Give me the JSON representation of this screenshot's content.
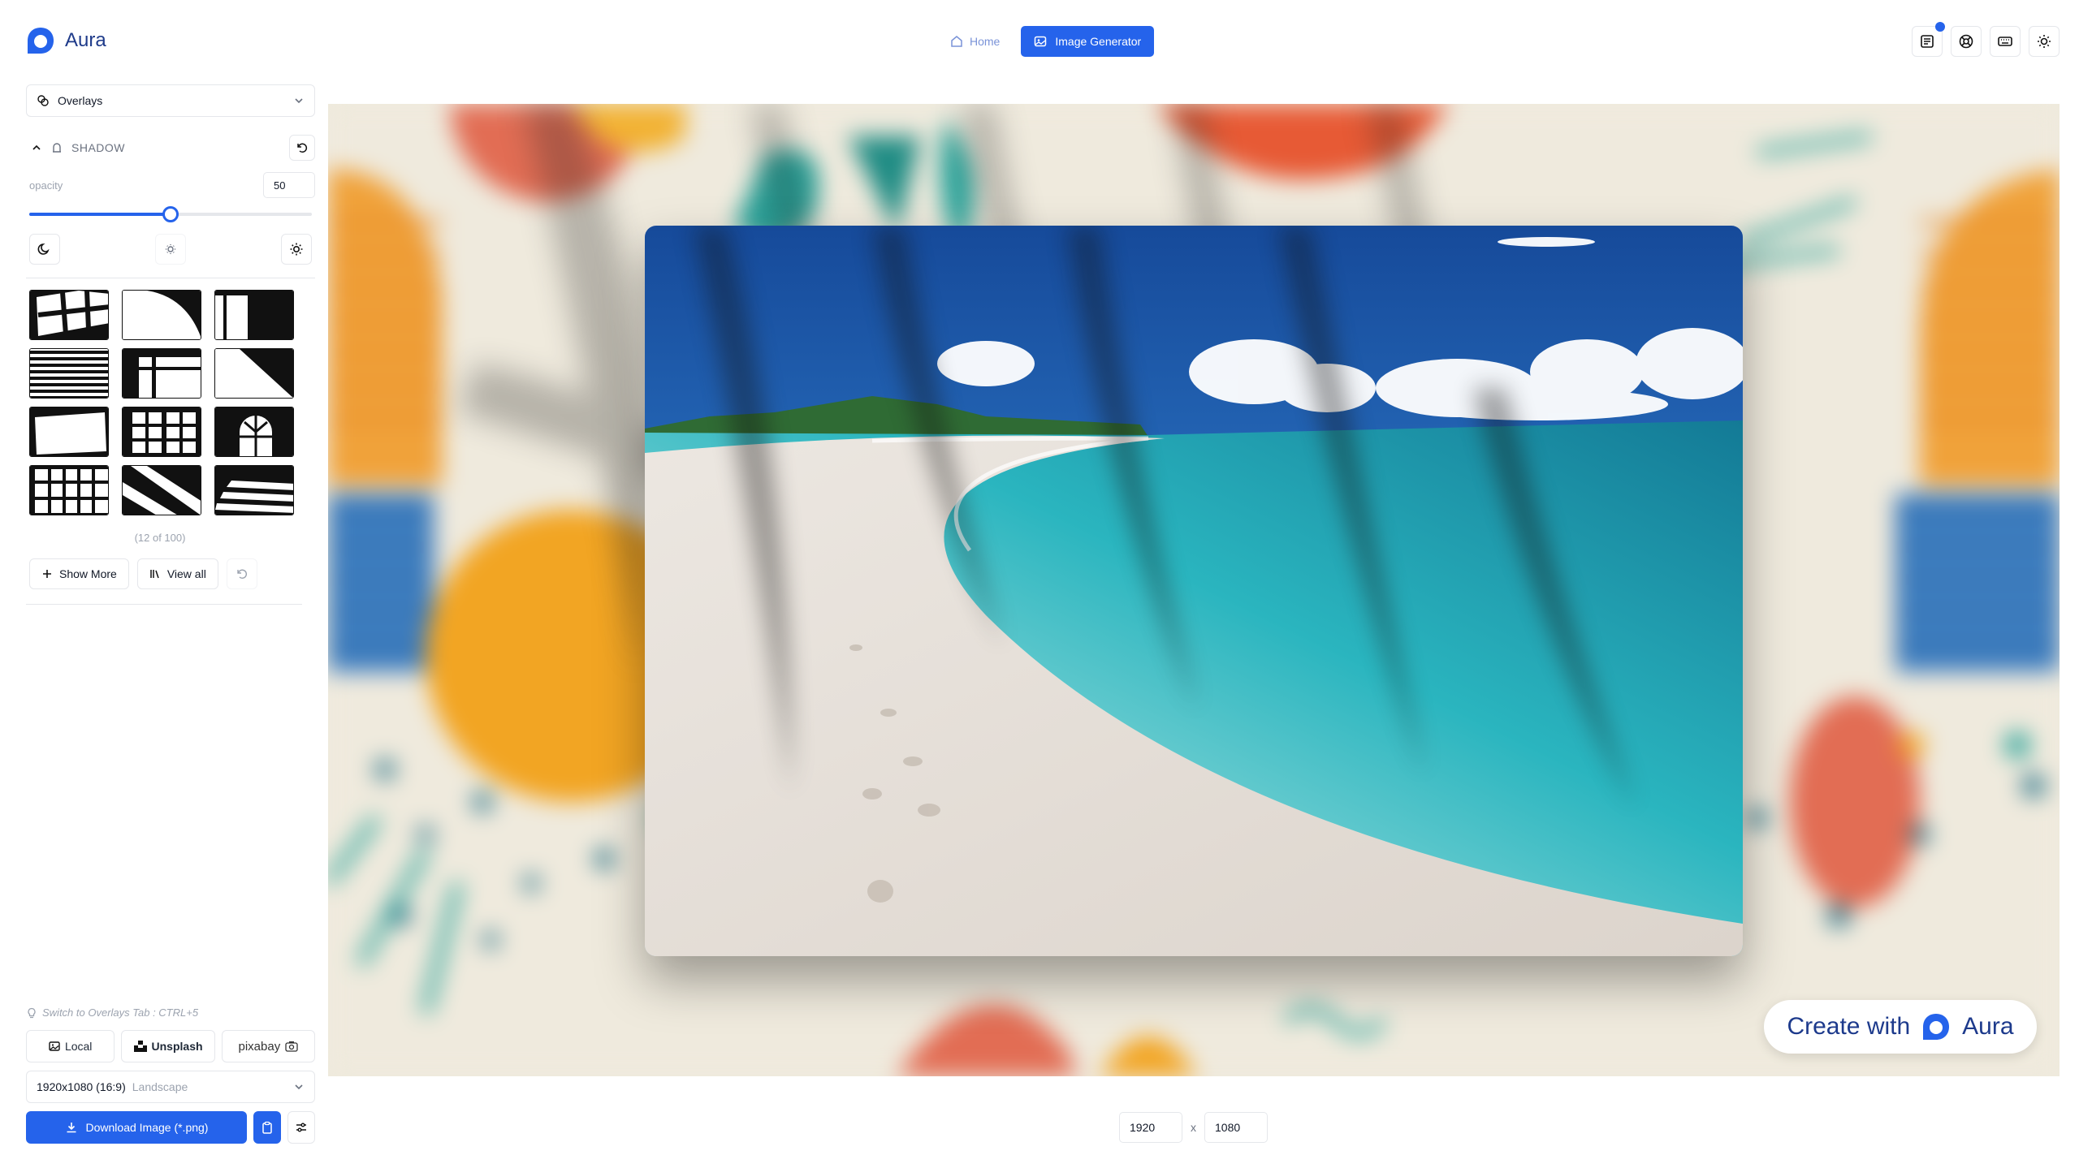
{
  "app": {
    "name": "Aura"
  },
  "nav": {
    "home": "Home",
    "generator": "Image Generator"
  },
  "sidebar": {
    "tab_select": "Overlays",
    "section_title": "SHADOW",
    "opacity_label": "opacity",
    "opacity_value": "50",
    "opacity_fraction": 0.5,
    "overlay_count": "(12 of 100)",
    "show_more": "Show More",
    "view_all": "View all",
    "hint": "Switch to Overlays Tab : CTRL+5",
    "sources": {
      "local": "Local",
      "unsplash": "Unsplash",
      "pixabay": "pixabay"
    },
    "size_select": {
      "value": "1920x1080 (16:9)",
      "orientation": "Landscape"
    },
    "download": "Download Image (*.png)"
  },
  "canvas": {
    "watermark_prefix": "Create with",
    "watermark_brand": "Aura"
  },
  "dimensions": {
    "width": "1920",
    "separator": "x",
    "height": "1080"
  },
  "colors": {
    "accent": "#2563eb",
    "brand": "#1d3a8c"
  }
}
